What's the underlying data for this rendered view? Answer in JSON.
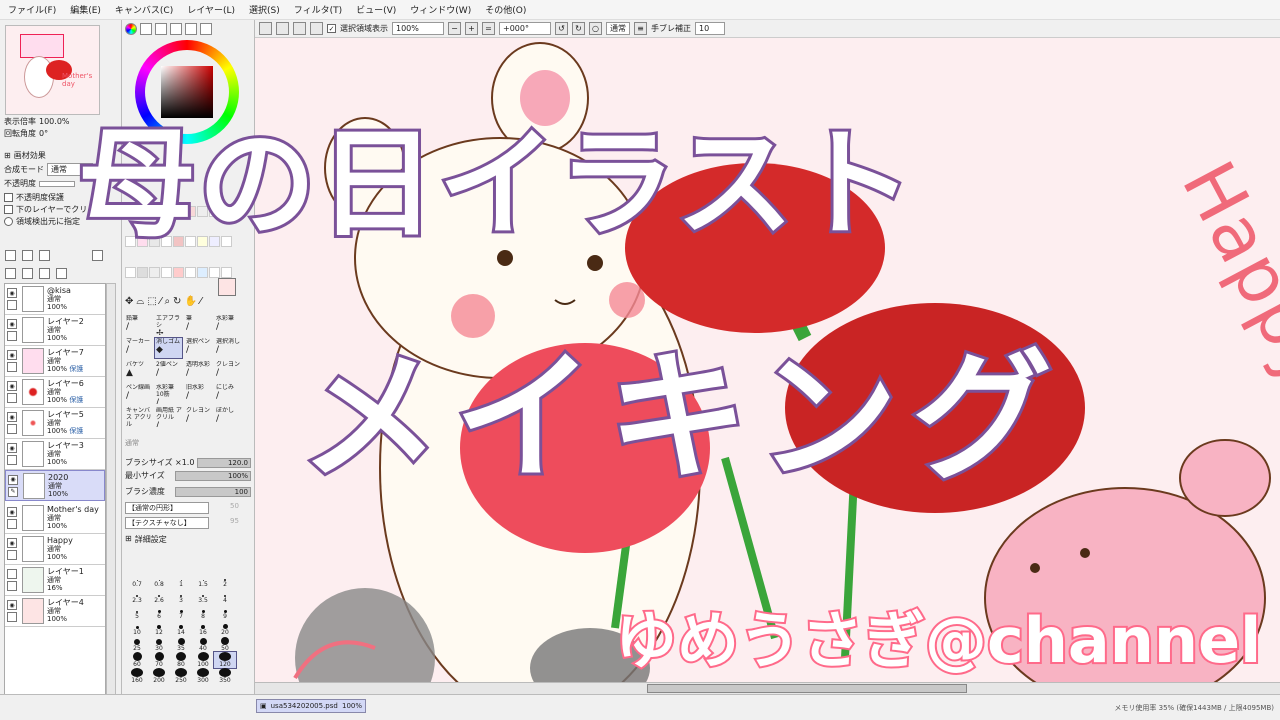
{
  "menu": [
    "ファイル(F)",
    "編集(E)",
    "キャンバス(C)",
    "レイヤー(L)",
    "選択(S)",
    "フィルタ(T)",
    "ビュー(V)",
    "ウィンドウ(W)",
    "その他(O)"
  ],
  "toolbar": {
    "selection_display_label": "選択領域表示",
    "zoom": "100%",
    "rotation": "+000°",
    "blend": "通常",
    "stabilizer_label": "手ブレ補正",
    "stabilizer_value": "10"
  },
  "navigator": {
    "zoom_label": "表示倍率",
    "zoom_value": "100.0%",
    "rotation_label": "回転角度",
    "rotation_value": "0°",
    "thumb_text": "Mother's day"
  },
  "layer_props": {
    "texture_label": "画材効果",
    "blend_mode_label": "合成モード",
    "blend_mode_value": "通常",
    "opacity_label": "不透明度",
    "preserve_opacity": "不透明度保護",
    "clip_lower": "下のレイヤーでクリッピング",
    "selection_source": "領域検出元に指定"
  },
  "layers": [
    {
      "name": "@kisa",
      "mode": "通常",
      "opacity": "100%",
      "protect": ""
    },
    {
      "name": "レイヤー2",
      "mode": "通常",
      "opacity": "100%",
      "protect": ""
    },
    {
      "name": "レイヤー7",
      "mode": "通常",
      "opacity": "100%",
      "protect": "保護"
    },
    {
      "name": "レイヤー6",
      "mode": "通常",
      "opacity": "100%",
      "protect": "保護"
    },
    {
      "name": "レイヤー5",
      "mode": "通常",
      "opacity": "100%",
      "protect": "保護"
    },
    {
      "name": "レイヤー3",
      "mode": "通常",
      "opacity": "100%",
      "protect": ""
    },
    {
      "name": "2020",
      "mode": "通常",
      "opacity": "100%",
      "protect": ""
    },
    {
      "name": "Mother's day",
      "mode": "通常",
      "opacity": "100%",
      "protect": ""
    },
    {
      "name": "Happy",
      "mode": "通常",
      "opacity": "100%",
      "protect": ""
    },
    {
      "name": "レイヤー1",
      "mode": "通常",
      "opacity": "16%",
      "protect": ""
    },
    {
      "name": "レイヤー4",
      "mode": "通常",
      "opacity": "100%",
      "protect": ""
    }
  ],
  "brushes": [
    {
      "label": "鉛筆",
      "icon": "/"
    },
    {
      "label": "エアブラシ",
      "icon": "✢"
    },
    {
      "label": "筆",
      "icon": "/"
    },
    {
      "label": "水彩筆",
      "icon": "/"
    },
    {
      "label": "マーカー",
      "icon": "/"
    },
    {
      "label": "消しゴム",
      "icon": "◆"
    },
    {
      "label": "選択ペン",
      "icon": "/"
    },
    {
      "label": "選択消し",
      "icon": "/"
    },
    {
      "label": "バケツ",
      "icon": "▲"
    },
    {
      "label": "2値ペン",
      "icon": "/"
    },
    {
      "label": "透明水彩",
      "icon": "/"
    },
    {
      "label": "クレヨン",
      "icon": "/"
    },
    {
      "label": "ペン線画",
      "icon": "/"
    },
    {
      "label": "水彩筆 10筋",
      "icon": "/"
    },
    {
      "label": "旧水彩",
      "icon": "/"
    },
    {
      "label": "にじみ",
      "icon": "/"
    },
    {
      "label": "キャンバス アクリル",
      "icon": "/"
    },
    {
      "label": "画用紙 アクリル",
      "icon": "/"
    },
    {
      "label": "クレヨン",
      "icon": "/"
    },
    {
      "label": "ぼかし",
      "icon": "/"
    }
  ],
  "brush_settings": {
    "blend": "通常",
    "size_label": "ブラシサイズ",
    "size_mult": "×1.0",
    "size_value": "120.0",
    "min_size_label": "最小サイズ",
    "min_size_value": "100%",
    "density_label": "ブラシ濃度",
    "density_value": "100",
    "shape": "【通常の円形】",
    "shape_value": "50",
    "texture": "【テクスチャなし】",
    "texture_value": "95",
    "detail_label": "詳細設定"
  },
  "dot_sizes": [
    "0.7",
    "0.8",
    "1",
    "1.5",
    "2",
    "2.3",
    "2.6",
    "3",
    "3.5",
    "4",
    "5",
    "6",
    "7",
    "8",
    "9",
    "10",
    "12",
    "14",
    "16",
    "20",
    "25",
    "30",
    "35",
    "40",
    "50",
    "60",
    "70",
    "80",
    "100",
    "120",
    "160",
    "200",
    "250",
    "300",
    "350"
  ],
  "overlay": {
    "line1": "母の日イラスト",
    "line2": "メイキング",
    "channel": "ゆめうさぎ@channel",
    "happy": "Happy"
  },
  "status": {
    "doc_name": "usa534202005.psd",
    "doc_zoom": "100%",
    "memory": "メモリ使用率 35% (確保1443MB / 上限4095MB)"
  },
  "colors": {
    "outline_purple": "#7a5199",
    "channel_pink": "#ff6a8a",
    "canvas_bg": "#fdeef0",
    "carnation_red": "#d42a2a"
  }
}
